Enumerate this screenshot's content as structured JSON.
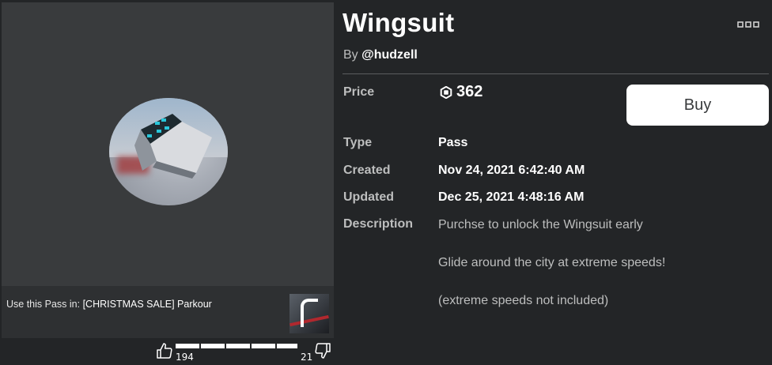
{
  "item": {
    "title": "Wingsuit",
    "by_prefix": "By",
    "creator": "@hudzell",
    "more_icon": "ellipsis-icon"
  },
  "details": {
    "price_label": "Price",
    "price_value": "362",
    "currency_icon": "robux-icon",
    "buy_label": "Buy",
    "type_label": "Type",
    "type_value": "Pass",
    "created_label": "Created",
    "created_value": "Nov 24, 2021 6:42:40 AM",
    "updated_label": "Updated",
    "updated_value": "Dec 25, 2021 4:48:16 AM",
    "description_label": "Description",
    "description_lines": [
      "Purchse to unlock the Wingsuit early",
      "Glide around the city at extreme speeds!",
      "(extreme speeds not included)"
    ]
  },
  "thumbnail": {
    "use_in_prefix": "Use this Pass in:",
    "game_name": "[CHRISTMAS SALE] Parkour"
  },
  "votes": {
    "up_count": "194",
    "down_count": "21",
    "up_ratio": 0.9,
    "up_icon": "thumbs-up-icon",
    "down_icon": "thumbs-down-icon"
  },
  "colors": {
    "background": "#232527",
    "panel": "#393b3d",
    "button": "#ffffff"
  }
}
